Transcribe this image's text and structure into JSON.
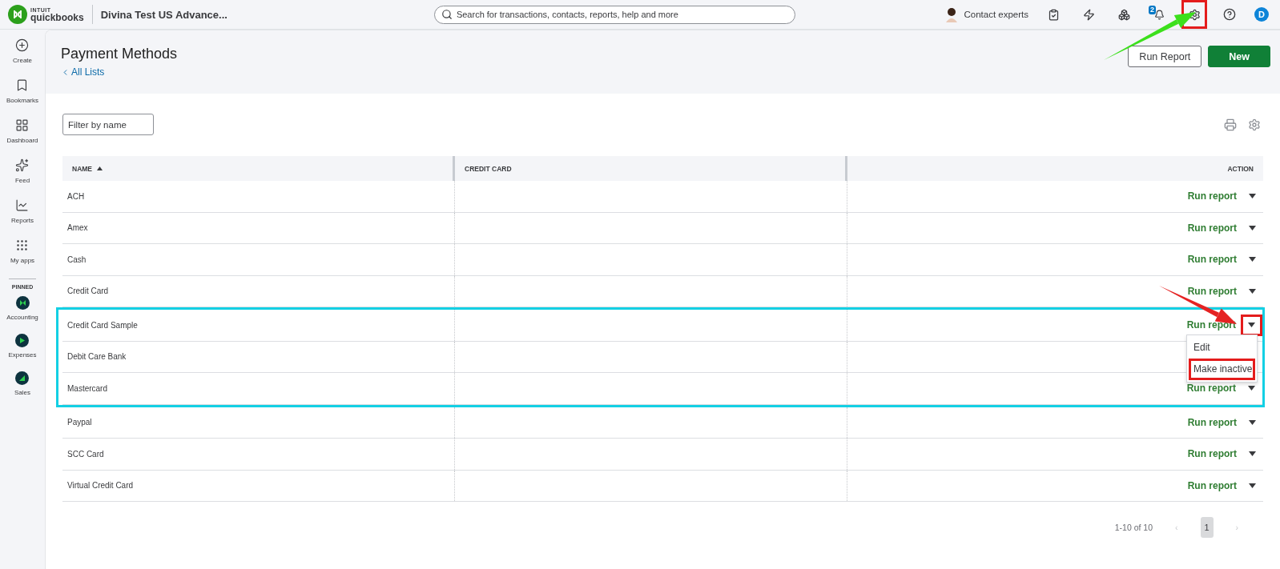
{
  "topbar": {
    "brand_top": "INTUIT",
    "brand": "quickbooks",
    "company": "Divina Test US Advance...",
    "search": {
      "placeholder": "Search for transactions, contacts, reports, help and more"
    },
    "contact": "Contact experts",
    "notification_count": "2",
    "settings_highlighted": true,
    "user_initial": "D"
  },
  "sidebar": {
    "items": [
      {
        "kind": "create",
        "label": "Create"
      },
      {
        "kind": "bookmarks",
        "label": "Bookmarks"
      },
      {
        "kind": "dashboard",
        "label": "Dashboard"
      },
      {
        "kind": "feed",
        "label": "Feed"
      },
      {
        "kind": "reports",
        "label": "Reports"
      },
      {
        "kind": "apps",
        "label": "My apps"
      }
    ],
    "pinned_heading": "PINNED",
    "pinned": [
      {
        "kind": "accounting",
        "label": "Accounting"
      },
      {
        "kind": "expenses",
        "label": "Expenses"
      },
      {
        "kind": "sales",
        "label": "Sales"
      }
    ]
  },
  "page": {
    "title": "Payment Methods",
    "back_link": "All Lists",
    "buttons": [
      {
        "kind": "secondary",
        "label": "Run Report"
      },
      {
        "kind": "primary",
        "label": "New"
      }
    ]
  },
  "filter": {
    "placeholder": "Filter by name"
  },
  "table": {
    "columns": [
      {
        "label": "NAME",
        "sorted": true
      },
      {
        "label": "CREDIT CARD"
      },
      {
        "label": "ACTION"
      }
    ],
    "rows": [
      {
        "name": "ACH",
        "action": "Run report",
        "framed": false,
        "menu_open": false
      },
      {
        "name": "Amex",
        "action": "Run report",
        "framed": false,
        "menu_open": false
      },
      {
        "name": "Cash",
        "action": "Run report",
        "framed": false,
        "menu_open": false
      },
      {
        "name": "Credit Card",
        "action": "Run report",
        "framed": false,
        "menu_open": false
      },
      {
        "name": "Credit Card Sample",
        "action": "Run report",
        "framed": true,
        "menu_open": true
      },
      {
        "name": "Debit Care Bank",
        "framed": true,
        "menu_open": false
      },
      {
        "name": "Mastercard",
        "action": "Run report",
        "framed": true,
        "menu_open": false
      },
      {
        "name": "Paypal",
        "action": "Run report",
        "framed": false,
        "menu_open": false
      },
      {
        "name": "SCC Card",
        "action": "Run report",
        "framed": false,
        "menu_open": false
      },
      {
        "name": "Virtual Credit Card",
        "action": "Run report",
        "framed": false,
        "menu_open": false
      }
    ],
    "row_menu": [
      {
        "label": "Edit",
        "highlighted": false
      },
      {
        "label": "Make inactive",
        "highlighted": true
      }
    ]
  },
  "pagination": {
    "range": "1-10 of 10",
    "prev": "‹",
    "pages": [
      {
        "label": "1",
        "selected": true
      }
    ],
    "next": "›"
  },
  "annotations": [
    {
      "kind": "arrow_to_settings",
      "color": "#3ce01c"
    },
    {
      "kind": "arrow_to_row_menu",
      "color": "#e52222"
    }
  ]
}
